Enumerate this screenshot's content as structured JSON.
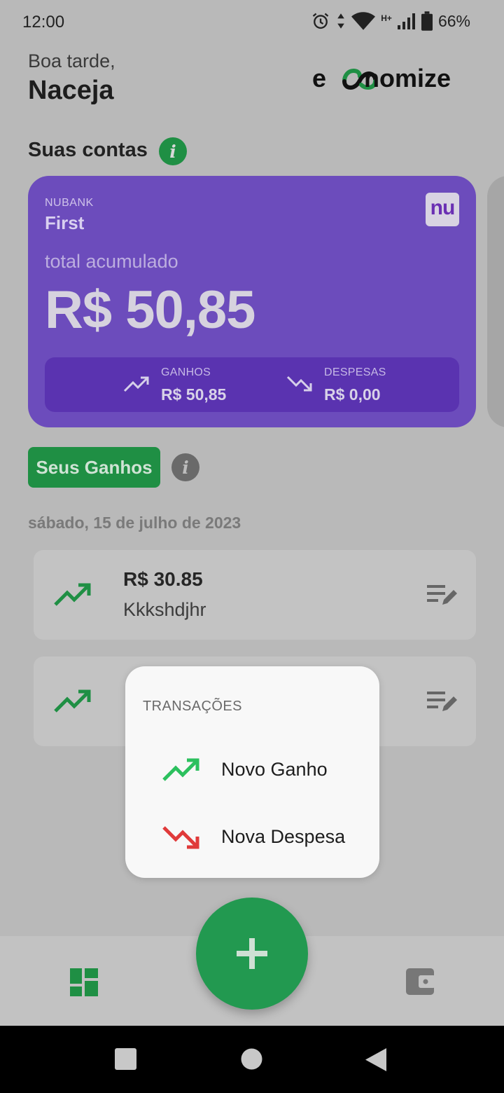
{
  "status_bar": {
    "time": "12:00",
    "icons": [
      "alarm-icon",
      "data-arrows-icon",
      "wifi-icon",
      "network-hplus-icon",
      "signal-icon",
      "battery-icon"
    ],
    "network_type": "H+",
    "battery": "66%"
  },
  "header": {
    "greeting": "Boa tarde,",
    "user_name": "Naceja",
    "logo_parts": {
      "start": "e",
      "end": "nomize"
    }
  },
  "accounts_section": {
    "title": "Suas contas",
    "info_icon": "i"
  },
  "account_card": {
    "bank": "NUBANK",
    "name": "First",
    "bank_logo_text": "nu",
    "total_label": "total acumulado",
    "total_value": "R$ 50,85",
    "gains_label": "GANHOS",
    "gains_value": "R$ 50,85",
    "expenses_label": "DESPESAS",
    "expenses_value": "R$ 0,00"
  },
  "gains_section": {
    "chip_label": "Seus Ganhos",
    "info_icon": "i",
    "date": "sábado, 15 de julho de 2023"
  },
  "transactions": [
    {
      "amount": "R$ 30.85",
      "description": "Kkkshdjhr"
    }
  ],
  "popup": {
    "title": "TRANSAÇÕES",
    "options": [
      {
        "label": "Novo Ganho",
        "icon": "trending-up-icon"
      },
      {
        "label": "Nova Despesa",
        "icon": "trending-down-icon"
      }
    ]
  },
  "bottom_nav": {
    "items": [
      "dashboard-icon",
      "plus-icon",
      "wallet-icon"
    ]
  },
  "colors": {
    "brand_green": "#229950",
    "card_purple": "#6c4cbc",
    "expense_red": "#e03a3a",
    "gain_green": "#2cc05e"
  }
}
